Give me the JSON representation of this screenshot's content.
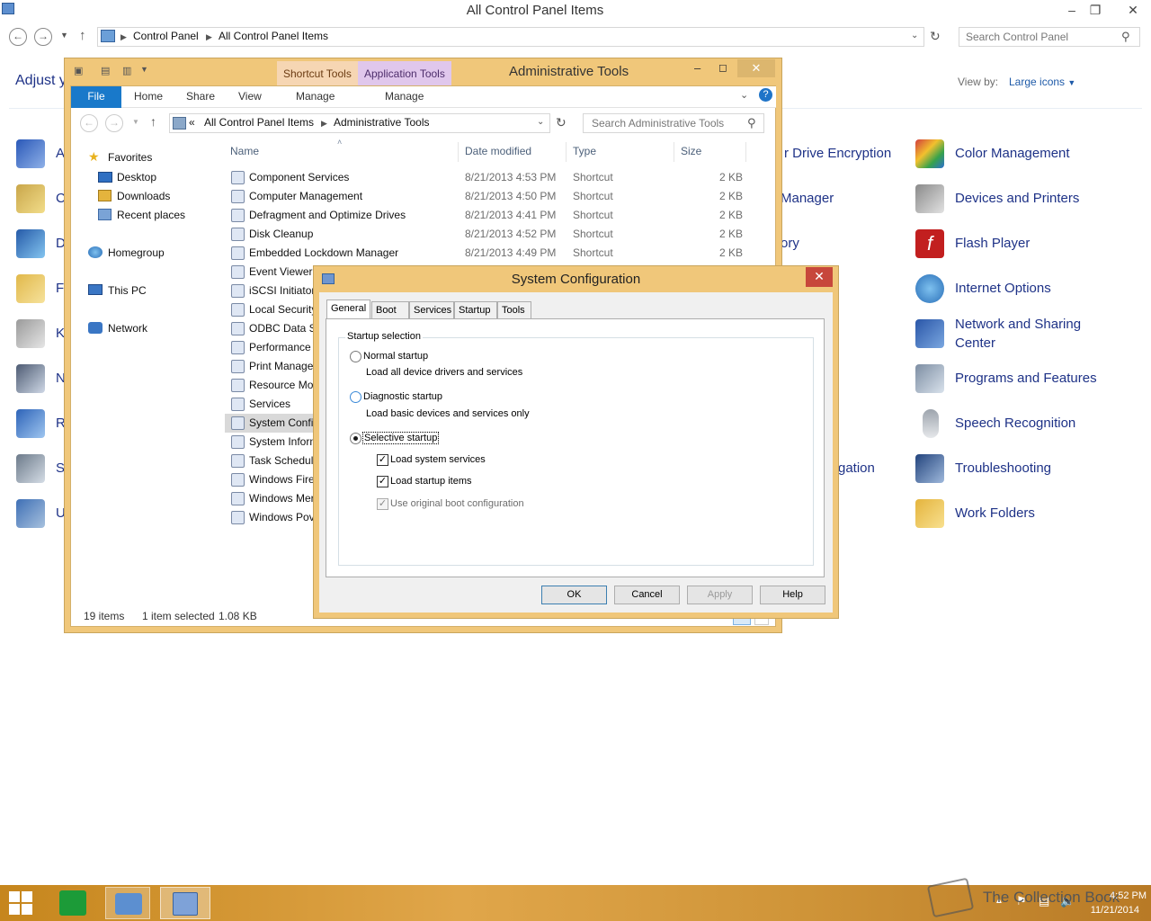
{
  "control_panel": {
    "title": "All Control Panel Items",
    "breadcrumb": [
      "Control Panel",
      "All Control Panel Items"
    ],
    "search_placeholder": "Search Control Panel",
    "heading": "Adjust y",
    "view_by_label": "View by:",
    "view_by_value": "Large icons",
    "left_items_truncated": [
      "A",
      "C",
      "D",
      "F",
      "K",
      "N",
      "R",
      "S",
      "U"
    ],
    "middle_items_partial": [
      "r Drive Encryption",
      "Manager",
      "ory",
      "gation"
    ],
    "right_items": [
      "Color Management",
      "Devices and Printers",
      "Flash Player",
      "Internet Options",
      "Network and Sharing",
      "Center",
      "Programs and Features",
      "Speech Recognition",
      "Troubleshooting",
      "Work Folders"
    ]
  },
  "admin_tools": {
    "title": "Administrative Tools",
    "context_tabs": [
      "Shortcut Tools",
      "Application Tools"
    ],
    "ribbon_tabs": [
      "File",
      "Home",
      "Share",
      "View",
      "Manage",
      "Manage"
    ],
    "breadcrumb": [
      "All Control Panel Items",
      "Administrative Tools"
    ],
    "breadcrumb_prefix": "«",
    "search_placeholder": "Search Administrative Tools",
    "nav": {
      "favorites": "Favorites",
      "desktop": "Desktop",
      "downloads": "Downloads",
      "recent": "Recent places",
      "homegroup": "Homegroup",
      "thispc": "This PC",
      "network": "Network"
    },
    "columns": [
      "Name",
      "Date modified",
      "Type",
      "Size"
    ],
    "files": [
      {
        "name": "Component Services",
        "date": "8/21/2013 4:53 PM",
        "type": "Shortcut",
        "size": "2 KB"
      },
      {
        "name": "Computer Management",
        "date": "8/21/2013 4:50 PM",
        "type": "Shortcut",
        "size": "2 KB"
      },
      {
        "name": "Defragment and Optimize Drives",
        "date": "8/21/2013 4:41 PM",
        "type": "Shortcut",
        "size": "2 KB"
      },
      {
        "name": "Disk Cleanup",
        "date": "8/21/2013 4:52 PM",
        "type": "Shortcut",
        "size": "2 KB"
      },
      {
        "name": "Embedded Lockdown Manager",
        "date": "8/21/2013 4:49 PM",
        "type": "Shortcut",
        "size": "2 KB"
      },
      {
        "name": "Event Viewer",
        "date": "",
        "type": "",
        "size": ""
      },
      {
        "name": "iSCSI Initiator",
        "date": "",
        "type": "",
        "size": ""
      },
      {
        "name": "Local Security",
        "date": "",
        "type": "",
        "size": ""
      },
      {
        "name": "ODBC Data So",
        "date": "",
        "type": "",
        "size": ""
      },
      {
        "name": "Performance",
        "date": "",
        "type": "",
        "size": ""
      },
      {
        "name": "Print Manage",
        "date": "",
        "type": "",
        "size": ""
      },
      {
        "name": "Resource Mon",
        "date": "",
        "type": "",
        "size": ""
      },
      {
        "name": "Services",
        "date": "",
        "type": "",
        "size": ""
      },
      {
        "name": "System Confi",
        "date": "",
        "type": "",
        "size": ""
      },
      {
        "name": "System Inforn",
        "date": "",
        "type": "",
        "size": ""
      },
      {
        "name": "Task Schedule",
        "date": "",
        "type": "",
        "size": ""
      },
      {
        "name": "Windows Fire",
        "date": "",
        "type": "",
        "size": ""
      },
      {
        "name": "Windows Mer",
        "date": "",
        "type": "",
        "size": ""
      },
      {
        "name": "Windows Pov",
        "date": "",
        "type": "",
        "size": ""
      }
    ],
    "status_count": "19 items",
    "status_selected": "1 item selected",
    "status_size": "1.08 KB"
  },
  "syscfg": {
    "title": "System Configuration",
    "tabs": [
      "General",
      "Boot",
      "Services",
      "Startup",
      "Tools"
    ],
    "group_label": "Startup selection",
    "normal": "Normal startup",
    "normal_desc": "Load all device drivers and services",
    "diagnostic": "Diagnostic startup",
    "diagnostic_desc": "Load basic devices and services only",
    "selective": "Selective startup",
    "load_system_services": "Load system services",
    "load_startup_items": "Load startup items",
    "use_original_boot": "Use original boot configuration",
    "buttons": {
      "ok": "OK",
      "cancel": "Cancel",
      "apply": "Apply",
      "help": "Help"
    }
  },
  "taskbar": {
    "date": "11/21/2014",
    "time": "4:52 PM",
    "watermark": "The Collection Book"
  }
}
